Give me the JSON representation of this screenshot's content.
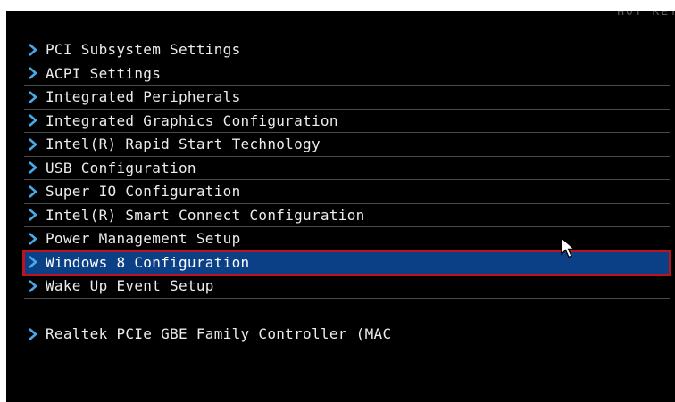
{
  "header": {
    "hotkey_text": "HOT KEY"
  },
  "menu": {
    "items": [
      {
        "label": "PCI Subsystem Settings"
      },
      {
        "label": "ACPI Settings"
      },
      {
        "label": "Integrated Peripherals"
      },
      {
        "label": "Integrated Graphics Configuration"
      },
      {
        "label": "Intel(R) Rapid Start Technology"
      },
      {
        "label": "USB Configuration"
      },
      {
        "label": "Super IO Configuration"
      },
      {
        "label": "Intel(R) Smart Connect Configuration"
      },
      {
        "label": "Power Management Setup"
      },
      {
        "label": "Windows 8 Configuration",
        "selected": true
      },
      {
        "label": "Wake Up Event Setup"
      }
    ],
    "extra_items": [
      {
        "label": "Realtek PCIe GBE Family Controller (MAC"
      }
    ]
  },
  "colors": {
    "background": "#000000",
    "selection": "#0b3f86",
    "highlight_border": "#c0121d",
    "chevron": "#4aa8e8",
    "text": "#ececec"
  },
  "icons": {
    "item_prefix": "chevron-right-icon",
    "pointer": "mouse-cursor-icon"
  }
}
